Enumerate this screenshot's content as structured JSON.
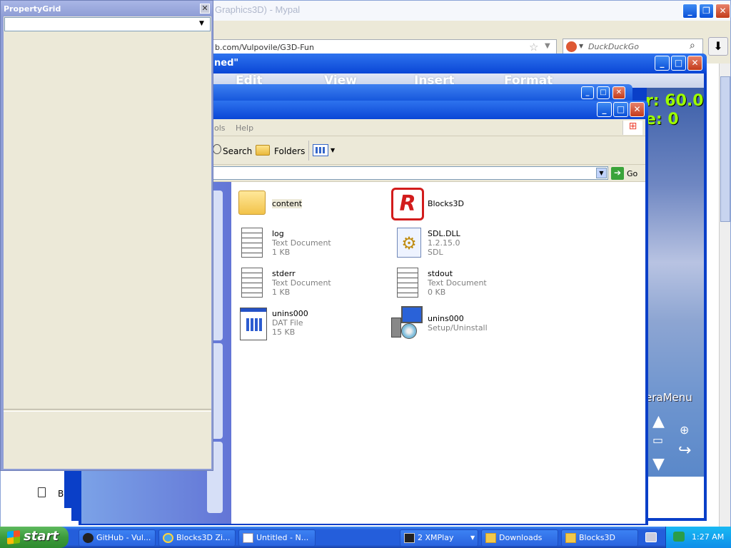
{
  "browser": {
    "title": "Graphics3D) - Mypal",
    "url": "b.com/Vulpovile/G3D-Fun",
    "search_placeholder": "DuckDuckGo"
  },
  "notepad": {
    "title": "ned\"",
    "menu": [
      "Edit",
      "View",
      "Insert",
      "Format"
    ]
  },
  "game": {
    "fps_text": "r: 60.0",
    "vel_text": "e: 0",
    "camera_menu": "eraMenu"
  },
  "explorer": {
    "menu": [
      "ols",
      "Help"
    ],
    "toolbar": {
      "search": "Search",
      "folders": "Folders"
    },
    "go_label": "Go",
    "files": [
      {
        "name": "content",
        "line1": "",
        "line2": ""
      },
      {
        "name": "Blocks3D",
        "line1": "",
        "line2": ""
      },
      {
        "name": "log",
        "line1": "Text Document",
        "line2": "1 KB"
      },
      {
        "name": "SDL.DLL",
        "line1": "1.2.15.0",
        "line2": "SDL"
      },
      {
        "name": "stderr",
        "line1": "Text Document",
        "line2": "1 KB"
      },
      {
        "name": "stdout",
        "line1": "Text Document",
        "line2": "0 KB"
      },
      {
        "name": "unins000",
        "line1": "DAT File",
        "line2": "15 KB"
      },
      {
        "name": "unins000",
        "line1": "Setup/Uninstall",
        "line2": ""
      }
    ]
  },
  "property_grid": {
    "title": "PropertyGrid",
    "selected": ""
  },
  "browser_sidebar": {
    "item": "B"
  },
  "taskbar": {
    "start": "start",
    "items": [
      "GitHub - Vul...",
      "Blocks3D Zi...",
      "Untitled - N...",
      "2 XMPlay",
      "Downloads",
      "Blocks3D"
    ],
    "clock": "1:27 AM"
  },
  "colors": {
    "xp_blue": "#0a3fc8",
    "taskbar": "#245edb",
    "start_green": "#3c9b3c",
    "tray": "#0f8ee9"
  }
}
